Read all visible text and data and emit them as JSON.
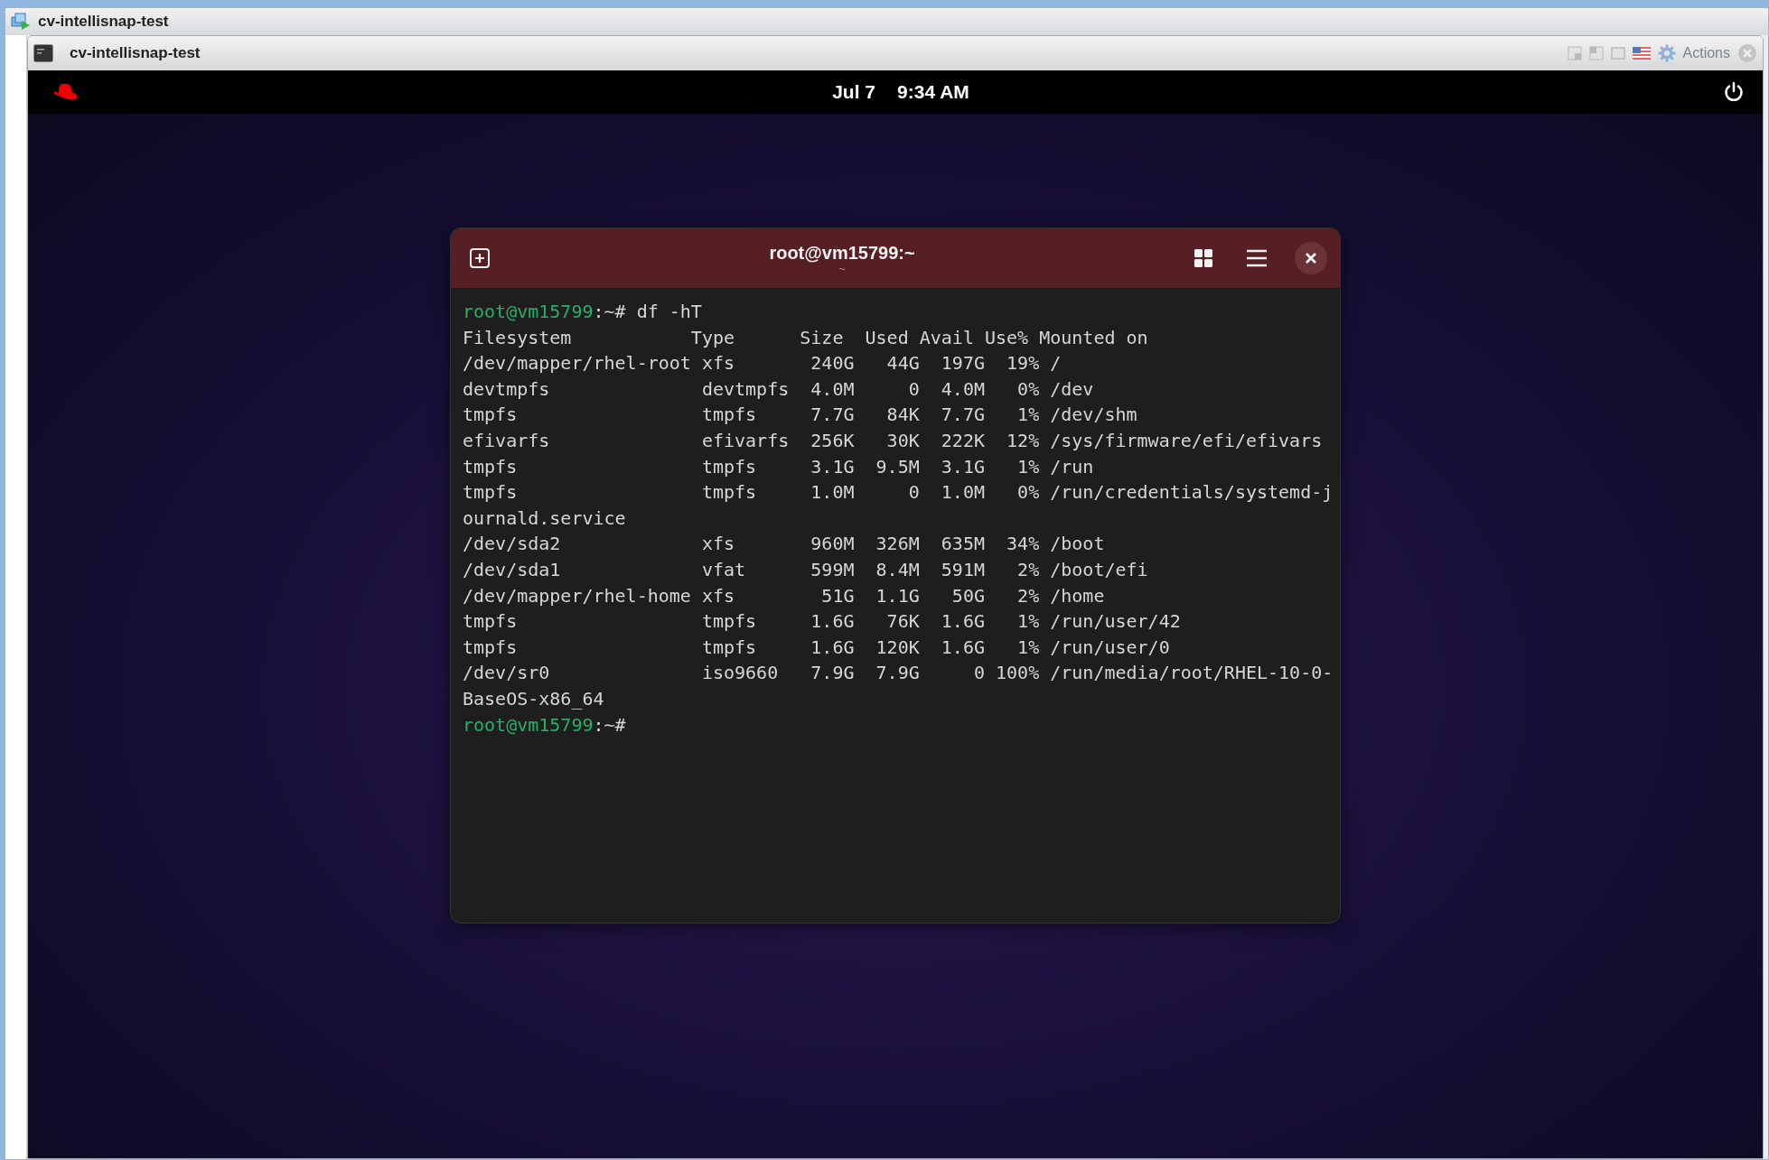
{
  "outer_window": {
    "title": "cv-intellisnap-test"
  },
  "console_window": {
    "title": "cv-intellisnap-test",
    "actions_label": "Actions"
  },
  "top_bar": {
    "date": "Jul 7",
    "time": "9:34 AM"
  },
  "terminal": {
    "title": "root@vm15799:~",
    "subtitle": "~",
    "lines": [
      {
        "kind": "prompt",
        "user": "root@vm15799",
        "rest": ":~# df -hT"
      },
      {
        "kind": "output",
        "text": "Filesystem           Type      Size  Used Avail Use% Mounted on"
      },
      {
        "kind": "output",
        "text": "/dev/mapper/rhel-root xfs       240G   44G  197G  19% /"
      },
      {
        "kind": "output",
        "text": "devtmpfs              devtmpfs  4.0M     0  4.0M   0% /dev"
      },
      {
        "kind": "output",
        "text": "tmpfs                 tmpfs     7.7G   84K  7.7G   1% /dev/shm"
      },
      {
        "kind": "output",
        "text": "efivarfs              efivarfs  256K   30K  222K  12% /sys/firmware/efi/efivars"
      },
      {
        "kind": "output",
        "text": "tmpfs                 tmpfs     3.1G  9.5M  3.1G   1% /run"
      },
      {
        "kind": "output",
        "text": "tmpfs                 tmpfs     1.0M     0  1.0M   0% /run/credentials/systemd-j"
      },
      {
        "kind": "output",
        "text": "ournald.service"
      },
      {
        "kind": "output",
        "text": "/dev/sda2             xfs       960M  326M  635M  34% /boot"
      },
      {
        "kind": "output",
        "text": "/dev/sda1             vfat      599M  8.4M  591M   2% /boot/efi"
      },
      {
        "kind": "output",
        "text": "/dev/mapper/rhel-home xfs        51G  1.1G   50G   2% /home"
      },
      {
        "kind": "output",
        "text": "tmpfs                 tmpfs     1.6G   76K  1.6G   1% /run/user/42"
      },
      {
        "kind": "output",
        "text": "tmpfs                 tmpfs     1.6G  120K  1.6G   1% /run/user/0"
      },
      {
        "kind": "output",
        "text": "/dev/sr0              iso9660   7.9G  7.9G     0 100% /run/media/root/RHEL-10-0-"
      },
      {
        "kind": "output",
        "text": "BaseOS-x86_64"
      },
      {
        "kind": "prompt",
        "user": "root@vm15799",
        "rest": ":~#"
      }
    ]
  }
}
